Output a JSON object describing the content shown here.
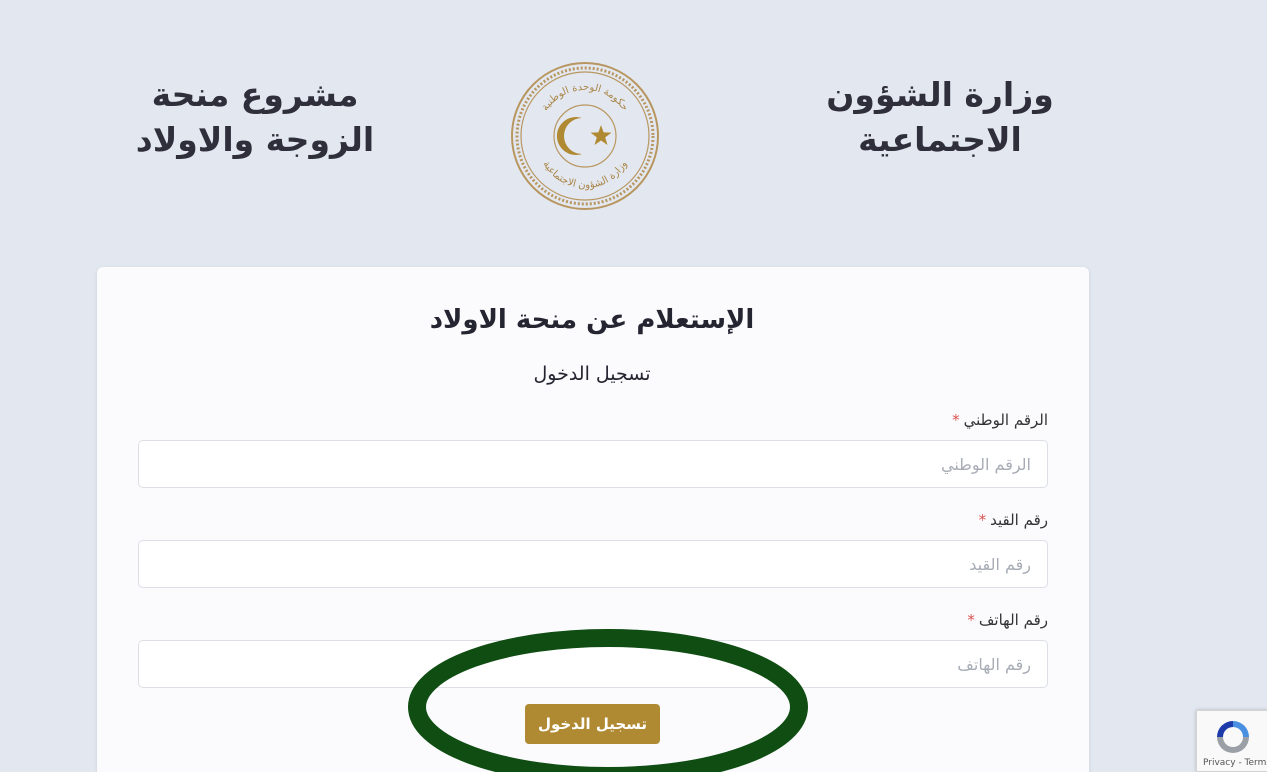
{
  "header": {
    "left_title_line1": "مشروع منحة",
    "left_title_line2": "الزوجة والاولاد",
    "right_title_line1": "وزارة الشؤون",
    "right_title_line2": "الاجتماعية",
    "seal_text_top": "حكومة الوحدة الوطنية",
    "seal_text_bottom": "وزارة الشؤون الاجتماعية"
  },
  "form": {
    "title": "الإستعلام عن منحة الاولاد",
    "subtitle": "تسجيل الدخول",
    "required_mark": "*",
    "fields": [
      {
        "label": "الرقم الوطني",
        "placeholder": "الرقم الوطني",
        "value": ""
      },
      {
        "label": "رقم القيد",
        "placeholder": "رقم القيد",
        "value": ""
      },
      {
        "label": "رقم الهاتف",
        "placeholder": "رقم الهاتف",
        "value": ""
      }
    ],
    "submit_label": "تسجيل الدخول"
  },
  "recaptcha": {
    "links": "Privacy - Terms"
  },
  "colors": {
    "background": "#e3e8f0",
    "accent": "#b08a33",
    "highlight": "#0f4d12",
    "required": "#d9534f"
  }
}
